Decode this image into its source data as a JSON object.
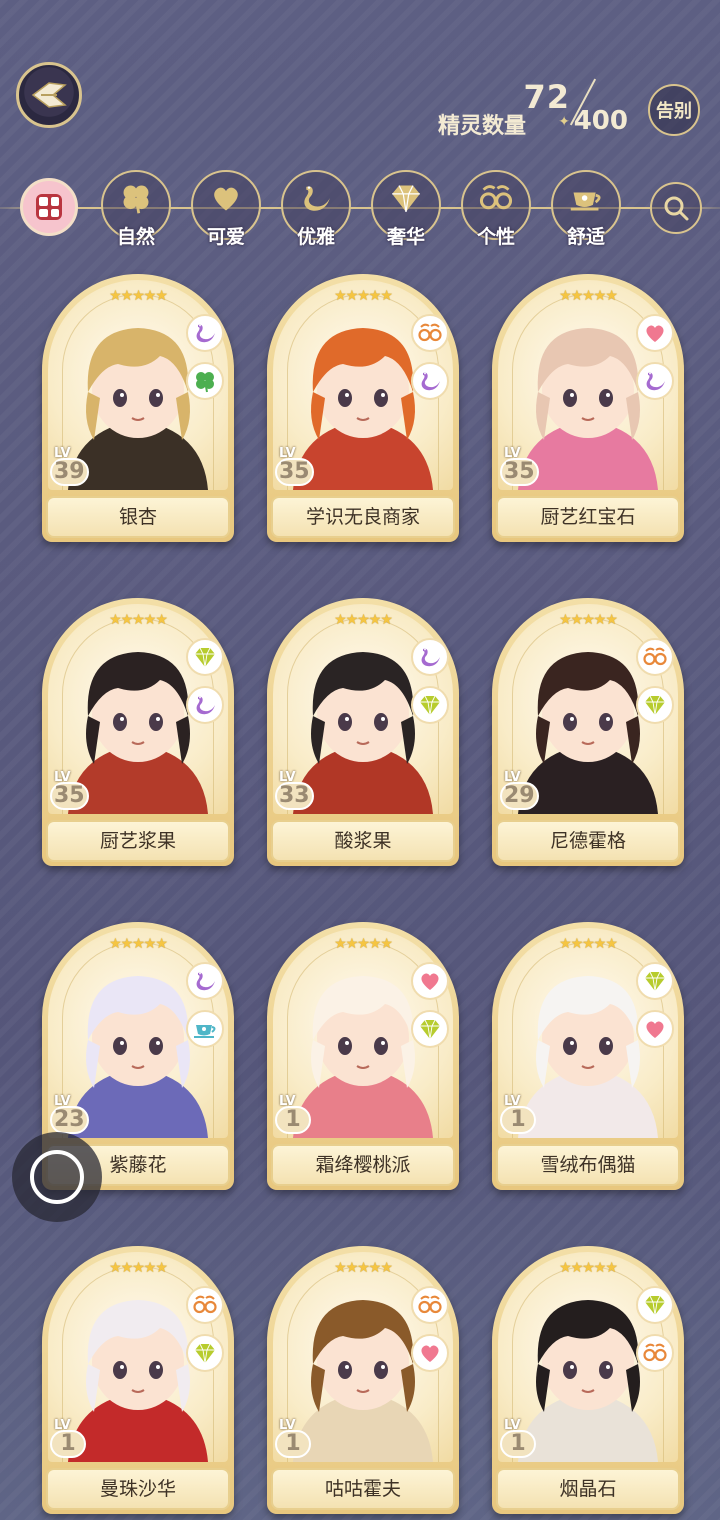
{
  "header": {
    "count_label": "精灵数量",
    "count_current": "72",
    "count_max": "400",
    "farewell_button": "告别"
  },
  "filters": [
    {
      "label": "自然",
      "icon": "clover-icon"
    },
    {
      "label": "可爱",
      "icon": "heart-icon"
    },
    {
      "label": "优雅",
      "icon": "swan-icon"
    },
    {
      "label": "奢华",
      "icon": "diamond-icon"
    },
    {
      "label": "个性",
      "icon": "glasses-icon"
    },
    {
      "label": "舒适",
      "icon": "teacup-icon"
    }
  ],
  "cards": [
    {
      "name": "银杏",
      "level": "39",
      "stars": 5,
      "tags": [
        "swan-icon",
        "clover-icon"
      ],
      "hair": "#d8b46a",
      "outfit": "#3b3026"
    },
    {
      "name": "学识无良商家",
      "level": "35",
      "stars": 5,
      "tags": [
        "glasses-icon",
        "swan-icon"
      ],
      "hair": "#e06a2a",
      "outfit": "#c8442e"
    },
    {
      "name": "厨艺红宝石",
      "level": "35",
      "stars": 5,
      "tags": [
        "heart-icon",
        "swan-icon"
      ],
      "hair": "#e8c7b2",
      "outfit": "#e77aa0"
    },
    {
      "name": "厨艺浆果",
      "level": "35",
      "stars": 5,
      "tags": [
        "diamond-icon",
        "swan-icon"
      ],
      "hair": "#2b2222",
      "outfit": "#b33b2a"
    },
    {
      "name": "酸浆果",
      "level": "33",
      "stars": 5,
      "tags": [
        "swan-icon",
        "diamond-icon"
      ],
      "hair": "#2a2424",
      "outfit": "#b13726"
    },
    {
      "name": "尼德霍格",
      "level": "29",
      "stars": 5,
      "tags": [
        "glasses-icon",
        "diamond-icon"
      ],
      "hair": "#3a2520",
      "outfit": "#2a2022"
    },
    {
      "name": "紫藤花",
      "level": "23",
      "stars": 5,
      "tags": [
        "swan-icon",
        "teacup-icon"
      ],
      "hair": "#eae6f6",
      "outfit": "#6c6ab8"
    },
    {
      "name": "霜绛樱桃派",
      "level": "1",
      "stars": 5,
      "tags": [
        "heart-icon",
        "diamond-icon"
      ],
      "hair": "#fbf2e6",
      "outfit": "#e87f8a"
    },
    {
      "name": "雪绒布偶猫",
      "level": "1",
      "stars": 5,
      "tags": [
        "diamond-icon",
        "heart-icon"
      ],
      "hair": "#f6f4f2",
      "outfit": "#f2e9e9"
    },
    {
      "name": "曼珠沙华",
      "level": "1",
      "stars": 5,
      "tags": [
        "glasses-icon",
        "diamond-icon"
      ],
      "hair": "#f1ecf0",
      "outfit": "#c32a2a"
    },
    {
      "name": "咕咕霍夫",
      "level": "1",
      "stars": 5,
      "tags": [
        "glasses-icon",
        "heart-icon"
      ],
      "hair": "#8a5a2a",
      "outfit": "#e8d6b5"
    },
    {
      "name": "烟晶石",
      "level": "1",
      "stars": 5,
      "tags": [
        "diamond-icon",
        "glasses-icon"
      ],
      "hair": "#241e1e",
      "outfit": "#e9e2d8"
    }
  ],
  "lv_prefix": "LV",
  "colors": {
    "accent_gold": "#d9c48e",
    "tag_heart": "#f07890",
    "tag_swan": "#a56ad0",
    "tag_diamond": "#b7cc2e",
    "tag_glasses": "#e8883a",
    "tag_clover": "#4caf50",
    "tag_teacup": "#4fb6c8"
  }
}
